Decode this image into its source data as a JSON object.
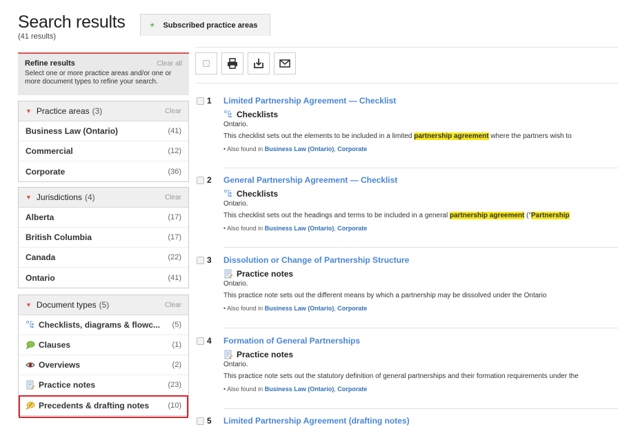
{
  "header": {
    "title": "Search results",
    "count": "(41 results)"
  },
  "tab": {
    "label": "Subscribed practice areas",
    "star": "*"
  },
  "refine": {
    "title": "Refine results",
    "clear": "Clear all",
    "description": "Select one or more practice areas and/or one or more document types to refine your search."
  },
  "facets": {
    "practice": {
      "title": "Practice areas",
      "count": "(3)",
      "clear": "Clear",
      "items": [
        {
          "label": "Business Law (Ontario)",
          "n": "(41)"
        },
        {
          "label": "Commercial",
          "n": "(12)"
        },
        {
          "label": "Corporate",
          "n": "(36)"
        }
      ]
    },
    "jurisdictions": {
      "title": "Jurisdictions",
      "count": "(4)",
      "clear": "Clear",
      "items": [
        {
          "label": "Alberta",
          "n": "(17)"
        },
        {
          "label": "British Columbia",
          "n": "(17)"
        },
        {
          "label": "Canada",
          "n": "(22)"
        },
        {
          "label": "Ontario",
          "n": "(41)"
        }
      ]
    },
    "doctypes": {
      "title": "Document types",
      "count": "(5)",
      "clear": "Clear",
      "items": [
        {
          "label": "Checklists, diagrams & flowc...",
          "n": "(5)",
          "icon": "checklist-icon"
        },
        {
          "label": "Clauses",
          "n": "(1)",
          "icon": "clause-bubble-icon"
        },
        {
          "label": "Overviews",
          "n": "(2)",
          "icon": "eye-icon"
        },
        {
          "label": "Practice notes",
          "n": "(23)",
          "icon": "practice-note-icon"
        },
        {
          "label": "Precedents & drafting notes",
          "n": "(10)",
          "icon": "precedent-icon"
        }
      ]
    }
  },
  "results": [
    {
      "num": "1",
      "title": "Limited Partnership Agreement — Checklist",
      "type": "Checklists",
      "jurisdiction": "Ontario.",
      "snippet_pre": "This checklist sets out the elements to be included in a limited ",
      "snippet_hl": "partnership agreement",
      "snippet_post": " where the partners wish to",
      "also_prefix": "• Also found in ",
      "also_a": "Business Law (Ontario)",
      "also_sep": ", ",
      "also_b": "Corporate"
    },
    {
      "num": "2",
      "title": "General Partnership Agreement — Checklist",
      "type": "Checklists",
      "jurisdiction": "Ontario.",
      "snippet_pre": "This checklist sets out the headings and terms to be included in a general ",
      "snippet_hl": "partnership agreement",
      "snippet_post": " (\"",
      "snippet_hl2": "Partnership",
      "also_prefix": "• Also found in ",
      "also_a": "Business Law (Ontario)",
      "also_sep": ", ",
      "also_b": "Corporate"
    },
    {
      "num": "3",
      "title": "Dissolution or Change of Partnership Structure",
      "type": "Practice notes",
      "jurisdiction": "Ontario.",
      "snippet_pre": "This practice note sets out the different means by which a partnership may be dissolved under the Ontario",
      "also_prefix": "• Also found in ",
      "also_a": "Business Law (Ontario)",
      "also_sep": ", ",
      "also_b": "Corporate"
    },
    {
      "num": "4",
      "title": "Formation of General Partnerships",
      "type": "Practice notes",
      "jurisdiction": "Ontario.",
      "snippet_pre": "This practice note sets out the statutory definition of general partnerships and their formation requirements under the",
      "also_prefix": "• Also found in ",
      "also_a": "Business Law (Ontario)",
      "also_sep": ", ",
      "also_b": "Corporate"
    },
    {
      "num": "5",
      "title": "Limited Partnership Agreement (drafting notes)"
    }
  ],
  "colors": {
    "accent_red": "#d9534f",
    "link_blue": "#4a86d4",
    "highlight_yellow": "#f5e61e",
    "selection_red": "#e0262b"
  }
}
